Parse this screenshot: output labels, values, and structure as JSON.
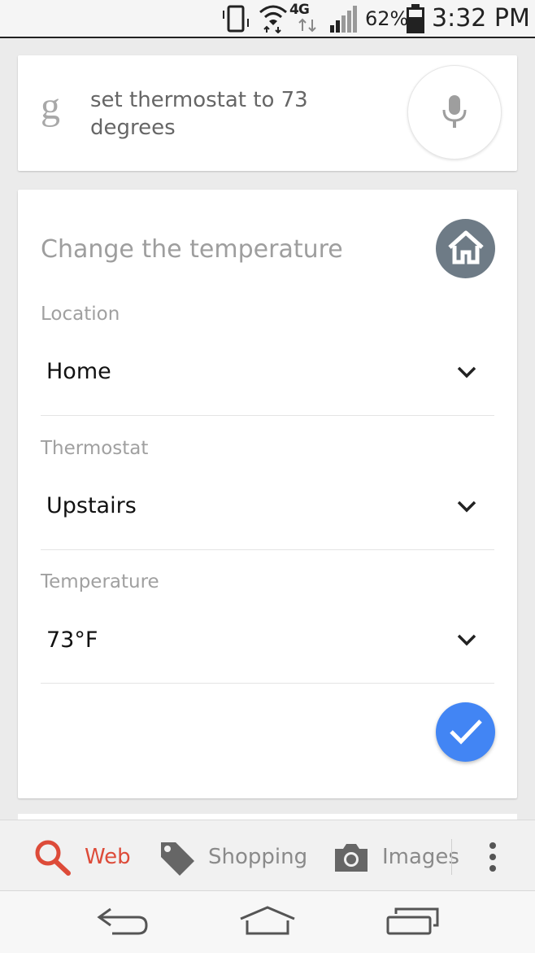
{
  "status_bar": {
    "network": "4G",
    "battery_percent": "62%",
    "time": "3:32 PM"
  },
  "search": {
    "logo": "g",
    "query": "set thermostat to 73 degrees"
  },
  "action_card": {
    "title": "Change the temperature",
    "fields": [
      {
        "label": "Location",
        "value": "Home"
      },
      {
        "label": "Thermostat",
        "value": "Upstairs"
      },
      {
        "label": "Temperature",
        "value": "73°F"
      }
    ]
  },
  "tabs": {
    "web": "Web",
    "shopping": "Shopping",
    "images": "Images"
  },
  "colors": {
    "accent_blue": "#4285f4",
    "active_tab_red": "#dd4b39",
    "home_badge_gray": "#6e7b86"
  },
  "icons": {
    "mic": "microphone-icon",
    "home": "home-icon",
    "confirm": "check-icon",
    "web": "search-icon",
    "shopping": "tag-icon",
    "images": "camera-icon"
  }
}
